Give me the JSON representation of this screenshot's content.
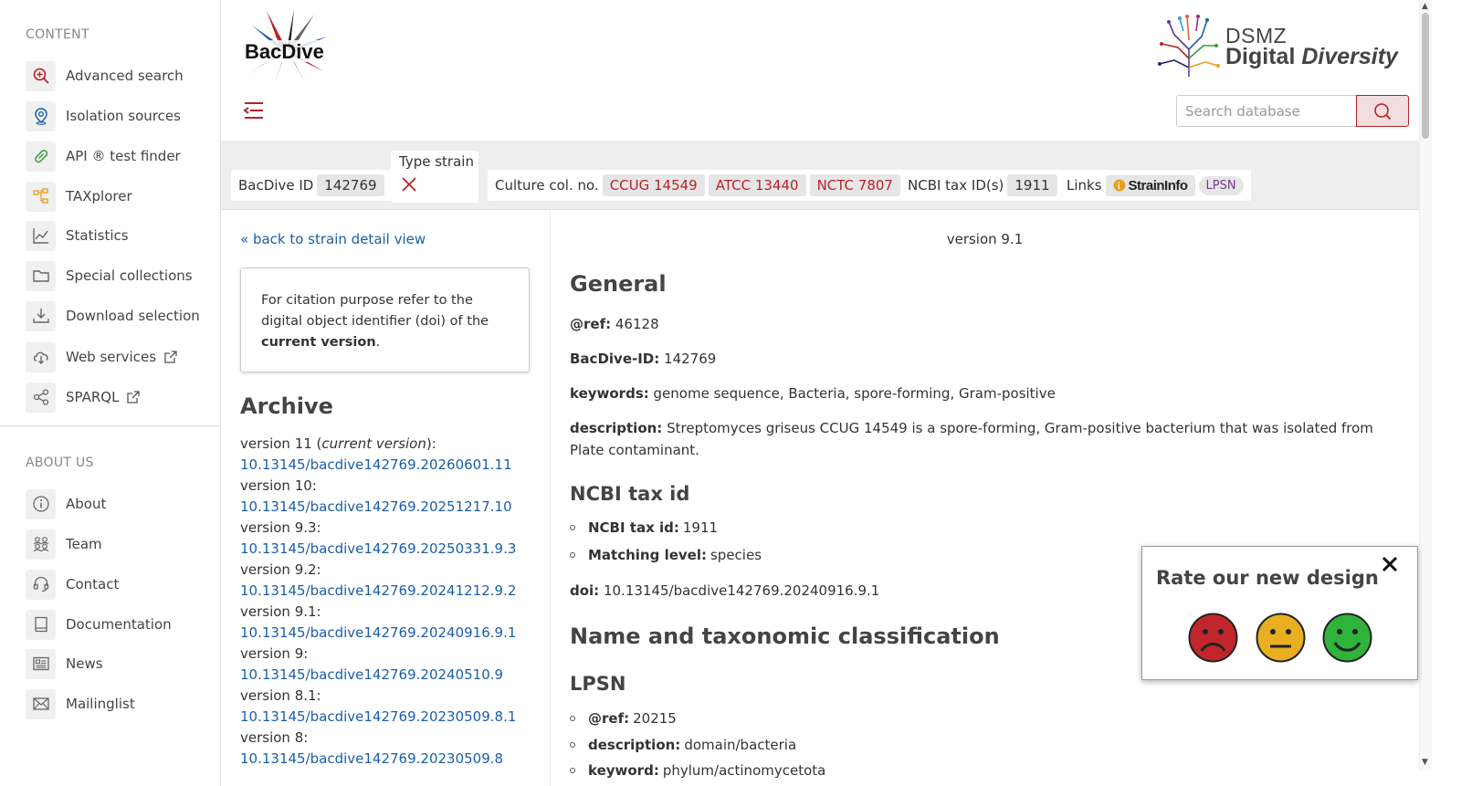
{
  "sidebar": {
    "content_title": "CONTENT",
    "content_items": [
      {
        "label": "Advanced search",
        "icon": "search-plus-icon"
      },
      {
        "label": "Isolation sources",
        "icon": "map-pin-icon"
      },
      {
        "label": "API ® test finder",
        "icon": "pill-icon"
      },
      {
        "label": "TAXplorer",
        "icon": "hierarchy-icon"
      },
      {
        "label": "Statistics",
        "icon": "line-chart-icon"
      },
      {
        "label": "Special collections",
        "icon": "folder-icon"
      },
      {
        "label": "Download selection",
        "icon": "download-icon"
      },
      {
        "label": "Web services",
        "icon": "cloud-download-icon"
      },
      {
        "label": "SPARQL",
        "icon": "share-nodes-icon"
      }
    ],
    "about_title": "ABOUT US",
    "about_items": [
      {
        "label": "About",
        "icon": "info-icon"
      },
      {
        "label": "Team",
        "icon": "team-icon"
      },
      {
        "label": "Contact",
        "icon": "headset-icon"
      },
      {
        "label": "Documentation",
        "icon": "book-icon"
      },
      {
        "label": "News",
        "icon": "newspaper-icon"
      },
      {
        "label": "Mailinglist",
        "icon": "envelope-icon"
      }
    ]
  },
  "header": {
    "logo_text": "BacDive",
    "dsmz_line1": "DSMZ",
    "dsmz_line2a": "Digital ",
    "dsmz_line2b": "Diversity",
    "search_placeholder": "Search database"
  },
  "strain_bar": {
    "bacdive_id_label": "BacDive ID",
    "bacdive_id": "142769",
    "type_strain_label": "Type strain",
    "culture_label": "Culture col. no.",
    "culture_numbers": [
      "CCUG 14549",
      "ATCC 13440",
      "NCTC 7807"
    ],
    "ncbi_label": "NCBI tax ID(s)",
    "ncbi_id": "1911",
    "links_label": "Links",
    "straininfo_label": "StrainInfo",
    "lpsn_label": "LPSN"
  },
  "left": {
    "back_link": "« back to strain detail view",
    "cite_pre": "For citation purpose refer to the digital object identifier (doi) of the ",
    "cite_bold": "current version",
    "cite_post": ".",
    "archive_title": "Archive",
    "archive": [
      {
        "version": "version 11 (",
        "current": "current version",
        "tail": "):",
        "doi": "10.13145/bacdive142769.20260601.11"
      },
      {
        "version": "version 10:",
        "current": "",
        "tail": "",
        "doi": "10.13145/bacdive142769.20251217.10"
      },
      {
        "version": "version 9.3:",
        "current": "",
        "tail": "",
        "doi": "10.13145/bacdive142769.20250331.9.3"
      },
      {
        "version": "version 9.2:",
        "current": "",
        "tail": "",
        "doi": "10.13145/bacdive142769.20241212.9.2"
      },
      {
        "version": "version 9.1:",
        "current": "",
        "tail": "",
        "doi": "10.13145/bacdive142769.20240916.9.1"
      },
      {
        "version": "version 9:",
        "current": "",
        "tail": "",
        "doi": "10.13145/bacdive142769.20240510.9"
      },
      {
        "version": "version 8.1:",
        "current": "",
        "tail": "",
        "doi": "10.13145/bacdive142769.20230509.8.1"
      },
      {
        "version": "version 8:",
        "current": "",
        "tail": "",
        "doi": "10.13145/bacdive142769.20230509.8"
      }
    ]
  },
  "main": {
    "version": "version 9.1",
    "general_title": "General",
    "ref_label": "@ref:",
    "ref_value": "46128",
    "bacdive_id_label": "BacDive-ID:",
    "bacdive_id_value": "142769",
    "keywords_label": "keywords:",
    "keywords_value": "genome sequence, Bacteria, spore-forming, Gram-positive",
    "description_label": "description:",
    "description_value": "Streptomyces griseus CCUG 14549 is a spore-forming, Gram-positive bacterium that was isolated from Plate contaminant.",
    "ncbi_title": "NCBI tax id",
    "ncbi_tax_label": "NCBI tax id:",
    "ncbi_tax_value": "1911",
    "matching_label": "Matching level:",
    "matching_value": "species",
    "doi_label": "doi:",
    "doi_value": "10.13145/bacdive142769.20240916.9.1",
    "name_title": "Name and taxonomic classification",
    "lpsn_title": "LPSN",
    "lpsn_ref_label": "@ref:",
    "lpsn_ref_value": "20215",
    "lpsn_desc_label": "description:",
    "lpsn_desc_value": "domain/bacteria",
    "lpsn_keyword_label": "keyword:",
    "lpsn_keyword_value": "phylum/actinomycetota"
  },
  "rating": {
    "title": "Rate our new design",
    "faces": [
      "sad-face-icon",
      "neutral-face-icon",
      "happy-face-icon"
    ]
  },
  "colors": {
    "brand_red": "#b5232a",
    "link_blue": "#1a5fa8"
  }
}
